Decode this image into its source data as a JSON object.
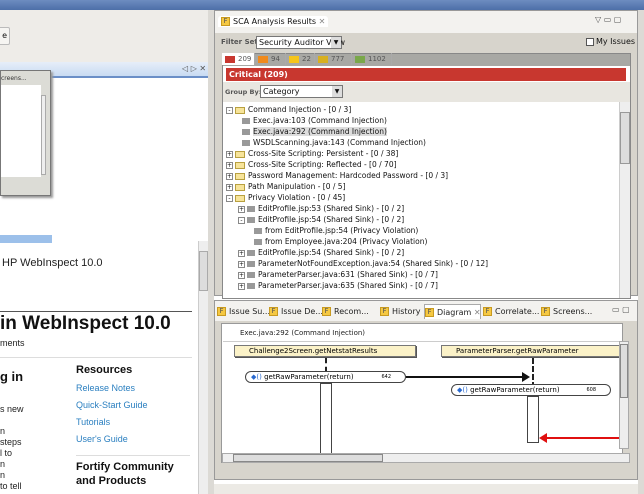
{
  "left": {
    "button_fragment": "e",
    "heading_small": "HP WebInspect 10.0",
    "heading_big": "in WebInspect 10.0",
    "subtitle": "ments",
    "section_heading": "g in",
    "body_fragments": [
      "s new",
      "n",
      "steps",
      "l to",
      "n",
      "n",
      "to tell"
    ],
    "resources": {
      "title": "Resources",
      "links": [
        "Release Notes",
        "Quick-Start Guide",
        "Tutorials",
        "User's Guide"
      ]
    },
    "community": {
      "title_line1": "Fortify Community",
      "title_line2": "and Products"
    },
    "embedded_tab": "creens..."
  },
  "sca": {
    "title": "SCA Analysis Results",
    "filter_label": "Filter Set:",
    "filter_value": "Security Auditor View",
    "my_issues": "My Issues",
    "severity_tabs": [
      {
        "count": "209",
        "color": "#c8372f"
      },
      {
        "count": "94",
        "color": "#f08a1c"
      },
      {
        "count": "22",
        "color": "#f6c51a"
      },
      {
        "count": "777",
        "color": "#d8b020"
      },
      {
        "count": "1102",
        "color": "#7aa84a"
      }
    ],
    "critical_banner": "Critical (209)",
    "group_label": "Group By:",
    "group_value": "Category",
    "tree": [
      {
        "label": "Command Injection - [0 / 3]",
        "level": 0,
        "type": "folder",
        "state": "-"
      },
      {
        "label": "Exec.java:103 (Command Injection)",
        "level": 1,
        "type": "item",
        "state": ""
      },
      {
        "label": "Exec.java:292 (Command Injection)",
        "level": 1,
        "type": "item",
        "state": "",
        "selected": true
      },
      {
        "label": "WSDLScanning.java:143 (Command Injection)",
        "level": 1,
        "type": "item",
        "state": ""
      },
      {
        "label": "Cross-Site Scripting: Persistent - [0 / 38]",
        "level": 0,
        "type": "folder",
        "state": "+"
      },
      {
        "label": "Cross-Site Scripting: Reflected - [0 / 70]",
        "level": 0,
        "type": "folder",
        "state": "+"
      },
      {
        "label": "Password Management: Hardcoded Password - [0 / 3]",
        "level": 0,
        "type": "folder",
        "state": "+"
      },
      {
        "label": "Path Manipulation - [0 / 5]",
        "level": 0,
        "type": "folder",
        "state": "+"
      },
      {
        "label": "Privacy Violation - [0 / 45]",
        "level": 0,
        "type": "folder",
        "state": "-"
      },
      {
        "label": "EditProfile.jsp:53 (Shared Sink) - [0 / 2]",
        "level": 1,
        "type": "item",
        "state": "+"
      },
      {
        "label": "EditProfile.jsp:54 (Shared Sink) - [0 / 2]",
        "level": 1,
        "type": "item",
        "state": "-"
      },
      {
        "label": "from EditProfile.jsp:54 (Privacy Violation)",
        "level": 2,
        "type": "item",
        "state": ""
      },
      {
        "label": "from Employee.java:204 (Privacy Violation)",
        "level": 2,
        "type": "item",
        "state": ""
      },
      {
        "label": "EditProfile.jsp:54 (Shared Sink) - [0 / 2]",
        "level": 1,
        "type": "item",
        "state": "+"
      },
      {
        "label": "ParameterNotFoundException.java:54 (Shared Sink) - [0 / 12]",
        "level": 1,
        "type": "item",
        "state": "+"
      },
      {
        "label": "ParameterParser.java:631 (Shared Sink) - [0 / 7]",
        "level": 1,
        "type": "item",
        "state": "+"
      },
      {
        "label": "ParameterParser.java:635 (Shared Sink) - [0 / 7]",
        "level": 1,
        "type": "item",
        "state": "+"
      }
    ]
  },
  "bottom": {
    "tabs": [
      "Issue Su...",
      "Issue De...",
      "Recom...",
      "History",
      "Diagram",
      "Correlate...",
      "Screens..."
    ],
    "active_tab": "Diagram",
    "diagram": {
      "title": "Exec.java:292 (Command Injection)",
      "lane1": "Challenge2Screen.getNetstatResults",
      "lane2": "ParameterParser.getRawParameter",
      "node1": {
        "label": "getRawParameter(return)",
        "line": "642"
      },
      "node2": {
        "label": "getRawParameter(return)",
        "line": "608"
      }
    }
  }
}
